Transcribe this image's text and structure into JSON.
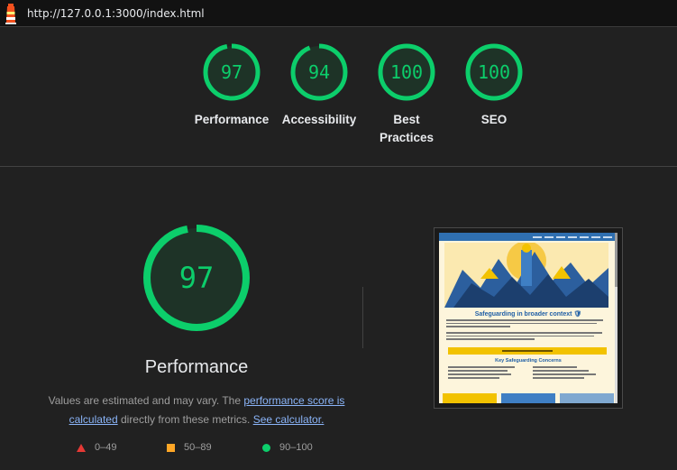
{
  "topbar": {
    "url": "http://127.0.0.1:3000/index.html",
    "logo_icon": "lighthouse-icon"
  },
  "colors": {
    "pass": "#0cce6b",
    "average": "#ffa726",
    "fail": "#e53935",
    "link": "#8ab4f8"
  },
  "categories": [
    {
      "score": 97,
      "label": "Performance"
    },
    {
      "score": 94,
      "label": "Accessibility"
    },
    {
      "score": 100,
      "label": "Best Practices"
    },
    {
      "score": 100,
      "label": "SEO"
    }
  ],
  "performance": {
    "score": 97,
    "title": "Performance",
    "desc_prefix": "Values are estimated and may vary. The ",
    "score_link": "performance score is calculated",
    "desc_middle": " directly from these metrics. ",
    "calc_link": "See calculator."
  },
  "legend": [
    {
      "icon": "red-triangle-icon",
      "range": "0–49"
    },
    {
      "icon": "orange-square-icon",
      "range": "50–89"
    },
    {
      "icon": "green-circle-icon",
      "range": "90–100"
    }
  ],
  "screenshot": {
    "heading": "Safeguarding in broader context 🛡",
    "subheading": "Key Safeguarding Concerns"
  }
}
